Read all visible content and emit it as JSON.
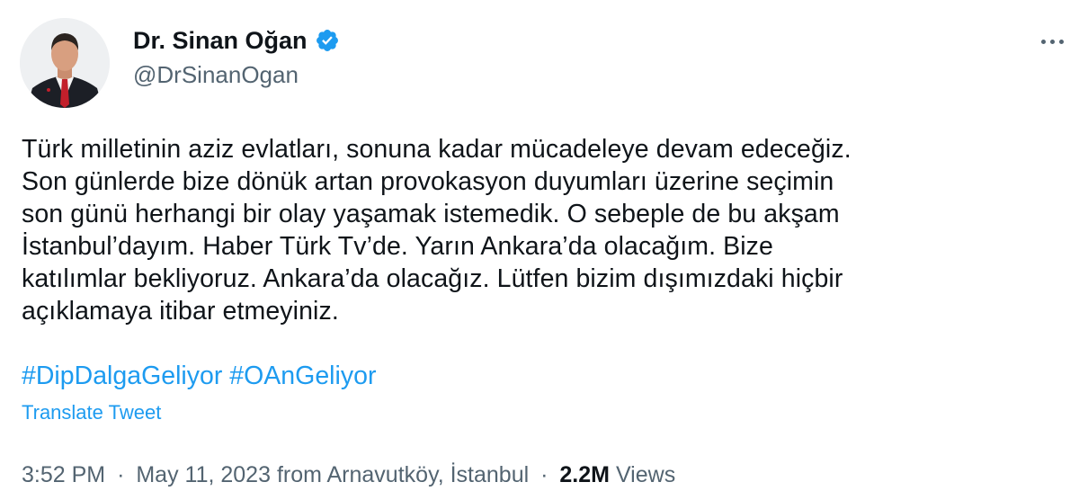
{
  "author": {
    "display_name": "Dr. Sinan Oğan",
    "handle": "@DrSinanOgan",
    "verified": true,
    "verified_color": "#1d9bf0"
  },
  "tweet": {
    "lines": [
      "Türk milletinin aziz evlatları, sonuna kadar mücadeleye devam edeceğiz.",
      "Son günlerde bize dönük artan provokasyon duyumları üzerine seçimin",
      "son günü herhangi bir olay yaşamak istemedik. O sebeple de bu akşam",
      "İstanbul’dayım. Haber Türk Tv’de. Yarın Ankara’da olacağım. Bize",
      "katılımlar bekliyoruz. Ankara’da olacağız. Lütfen bizim dışımızdaki hiçbir",
      "açıklamaya itibar etmeyiniz."
    ],
    "hashtags": [
      "#DipDalgaGeliyor",
      "#OAnGeliyor"
    ],
    "translate_label": "Translate Tweet"
  },
  "meta": {
    "time": "3:52 PM",
    "date": "May 11, 2023",
    "location": "from Arnavutköy, İstanbul",
    "separator": "·",
    "views_count": "2.2M",
    "views_label": "Views"
  },
  "icons": {
    "verified": "verified-badge-icon",
    "more": "more-horizontal-icon"
  },
  "colors": {
    "link": "#1d9bf0",
    "text": "#0f1419",
    "secondary": "#536471"
  }
}
